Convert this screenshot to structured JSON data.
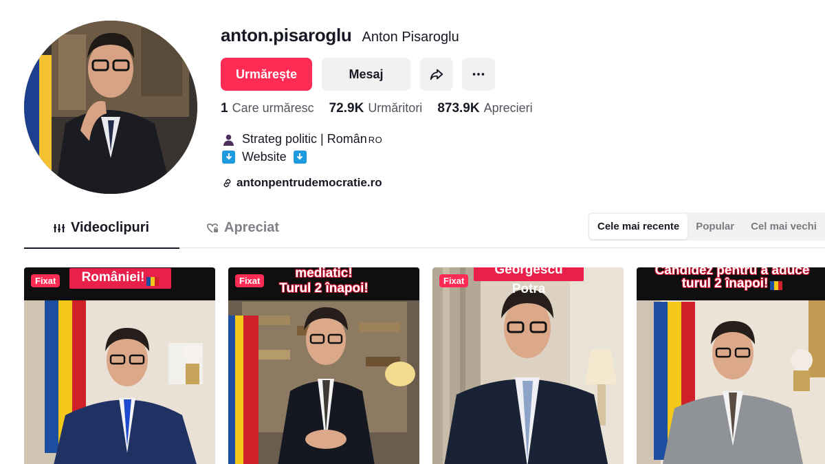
{
  "profile": {
    "username": "anton.pisaroglu",
    "nickname": "Anton Pisaroglu",
    "avatar_alt": "avatar"
  },
  "actions": {
    "follow_label": "Urmărește",
    "message_label": "Mesaj",
    "share_icon": "share-icon",
    "more_icon": "more-icon"
  },
  "stats": {
    "following_count": "1",
    "following_label": "Care urmăresc",
    "followers_count": "72.9K",
    "followers_label": "Urmăritori",
    "likes_count": "873.9K",
    "likes_label": "Aprecieri"
  },
  "bio": {
    "line1": "Strateg politic | Român",
    "line1_suffix": "RO",
    "line2": "Website"
  },
  "link": {
    "url": "antonpentrudemocratie.ro"
  },
  "tabs": {
    "videos": "Videoclipuri",
    "liked": "Apreciat"
  },
  "sort": {
    "options": [
      "Cele mai recente",
      "Popular",
      "Cel mai vechi"
    ],
    "active": "Cele mai recente"
  },
  "videos": [
    {
      "badge": "Fixat",
      "caption": "României!"
    },
    {
      "badge": "Fixat",
      "caption_line1": "mediatic!",
      "caption_line2": "Turul 2 înapoi!"
    },
    {
      "badge": "Fixat",
      "caption": "Georgescu Potra"
    },
    {
      "caption_line1": "Candidez pentru a aduce",
      "caption_line2": "turul 2 înapoi!"
    }
  ],
  "colors": {
    "accent": "#fe2c55",
    "text": "#161823",
    "button_bg": "#f1f1f2",
    "link_icon_bg": "#1e9ae0"
  }
}
